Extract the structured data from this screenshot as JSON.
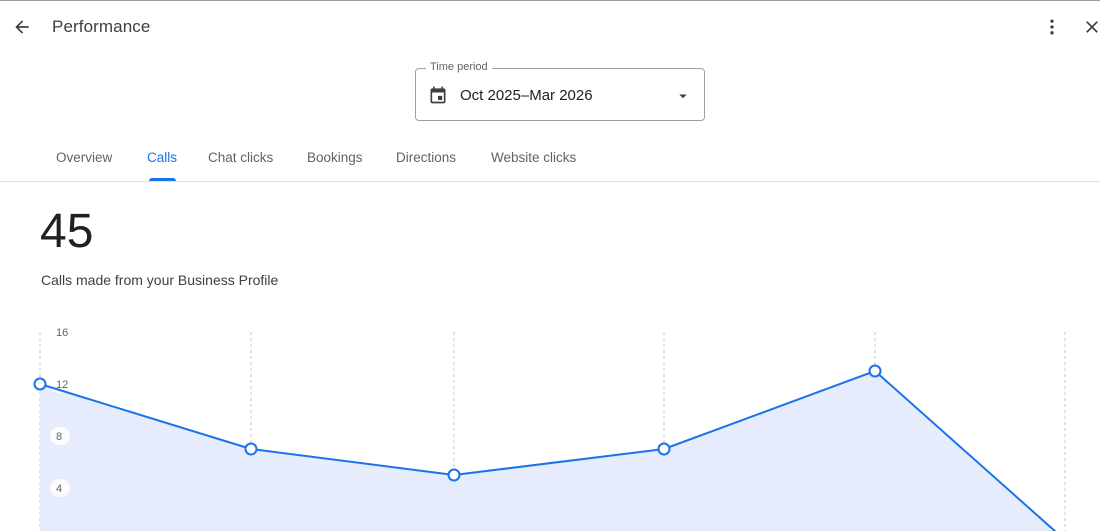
{
  "header": {
    "title": "Performance",
    "back_icon": "arrow-back-icon",
    "more_icon": "more-vert-icon",
    "close_icon": "close-icon"
  },
  "time_period": {
    "label": "Time period",
    "value": "Oct 2025–Mar 2026",
    "calendar_icon": "calendar-icon",
    "caret_icon": "arrow-drop-down-icon"
  },
  "tabs": [
    {
      "label": "Overview",
      "active": false
    },
    {
      "label": "Calls",
      "active": true
    },
    {
      "label": "Chat clicks",
      "active": false
    },
    {
      "label": "Bookings",
      "active": false
    },
    {
      "label": "Directions",
      "active": false
    },
    {
      "label": "Website clicks",
      "active": false
    }
  ],
  "metric": {
    "value": "45",
    "label": "Calls made from your Business Profile"
  },
  "colors": {
    "accent": "#1a73e8",
    "area_fill": "#e3eafc",
    "gridline": "#c7c9cc",
    "text_secondary": "#5f6368"
  },
  "chart_data": {
    "type": "area",
    "x": [
      0,
      1,
      2,
      3,
      4,
      5
    ],
    "values": [
      12,
      7,
      5,
      7,
      13,
      0
    ],
    "ylim": [
      0,
      16
    ],
    "yticks": [
      4,
      8,
      12,
      16
    ],
    "grid": "vertical-dashed",
    "title": "",
    "xlabel": "",
    "ylabel": ""
  }
}
